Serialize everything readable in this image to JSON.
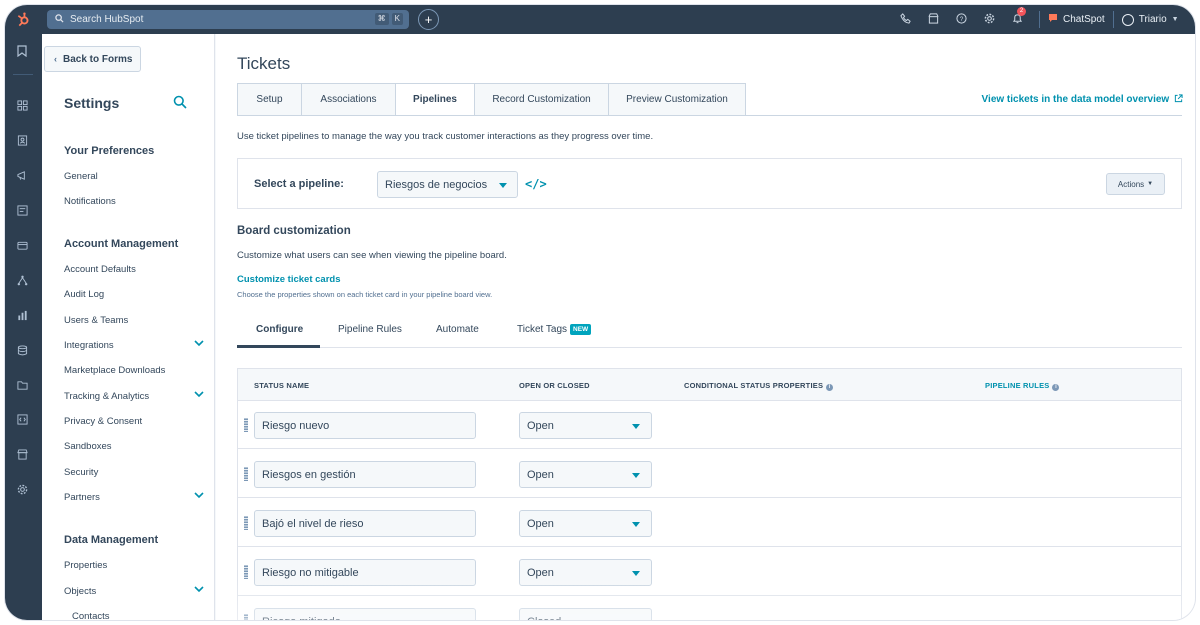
{
  "colors": {
    "topbar": "#2d3e50",
    "accent": "#0091ae",
    "logo": "#ff7a59",
    "badge_new": "#00a4bd"
  },
  "topbar": {
    "search_placeholder": "Search HubSpot",
    "shortcut_keys": [
      "⌘",
      "K"
    ],
    "notification_count": "2",
    "chatspot_label": "ChatSpot",
    "user_name": "Triario",
    "icons": [
      "phone-icon",
      "marketplace-icon",
      "help-icon",
      "gear-icon",
      "bell-icon"
    ]
  },
  "rail": {
    "icons": [
      "bookmark-icon",
      "grid-icon",
      "contacts-icon",
      "megaphone-icon",
      "content-icon",
      "commerce-icon",
      "automation-icon",
      "reports-icon",
      "database-icon",
      "folder-icon",
      "code-icon",
      "store-icon",
      "settings-icon"
    ]
  },
  "sidebar": {
    "back_label": "Back to Forms",
    "title": "Settings",
    "sections": [
      {
        "title": "Your Preferences",
        "items": [
          {
            "label": "General"
          },
          {
            "label": "Notifications"
          }
        ]
      },
      {
        "title": "Account Management",
        "items": [
          {
            "label": "Account Defaults"
          },
          {
            "label": "Audit Log"
          },
          {
            "label": "Users & Teams"
          },
          {
            "label": "Integrations"
          },
          {
            "label": "Marketplace Downloads"
          },
          {
            "label": "Tracking & Analytics"
          },
          {
            "label": "Privacy & Consent"
          },
          {
            "label": "Sandboxes"
          },
          {
            "label": "Security"
          },
          {
            "label": "Partners"
          }
        ]
      },
      {
        "title": "Data Management",
        "items": [
          {
            "label": "Properties"
          },
          {
            "label": "Objects"
          },
          {
            "label": "Contacts"
          }
        ]
      }
    ]
  },
  "main": {
    "title": "Tickets",
    "tabs": [
      {
        "label": "Setup"
      },
      {
        "label": "Associations"
      },
      {
        "label": "Pipelines"
      },
      {
        "label": "Record Customization"
      },
      {
        "label": "Preview Customization"
      }
    ],
    "overview_link": "View tickets in the data model overview",
    "intro": "Use ticket pipelines to manage the way you track customer interactions as they progress over time.",
    "pipeline_label": "Select a pipeline:",
    "pipeline_value": "Riesgos de negocios",
    "actions_label": "Actions",
    "board_title": "Board customization",
    "board_desc": "Customize what users can see when viewing the pipeline board.",
    "customize_link": "Customize ticket cards",
    "customize_desc": "Choose the properties shown on each ticket card in your pipeline board view.",
    "subtabs": [
      {
        "label": "Configure"
      },
      {
        "label": "Pipeline Rules"
      },
      {
        "label": "Automate"
      },
      {
        "label": "Ticket Tags"
      }
    ],
    "new_badge": "NEW",
    "table": {
      "headers": [
        "STATUS NAME",
        "OPEN OR CLOSED",
        "CONDITIONAL STATUS PROPERTIES",
        "PIPELINE RULES"
      ],
      "rows": [
        {
          "name": "Riesgo nuevo",
          "state": "Open"
        },
        {
          "name": "Riesgos en gestión",
          "state": "Open"
        },
        {
          "name": "Bajó el nivel de rieso",
          "state": "Open"
        },
        {
          "name": "Riesgo no mitigable",
          "state": "Open"
        },
        {
          "name": "Riesgo mitigado",
          "state": "Closed"
        }
      ]
    }
  }
}
